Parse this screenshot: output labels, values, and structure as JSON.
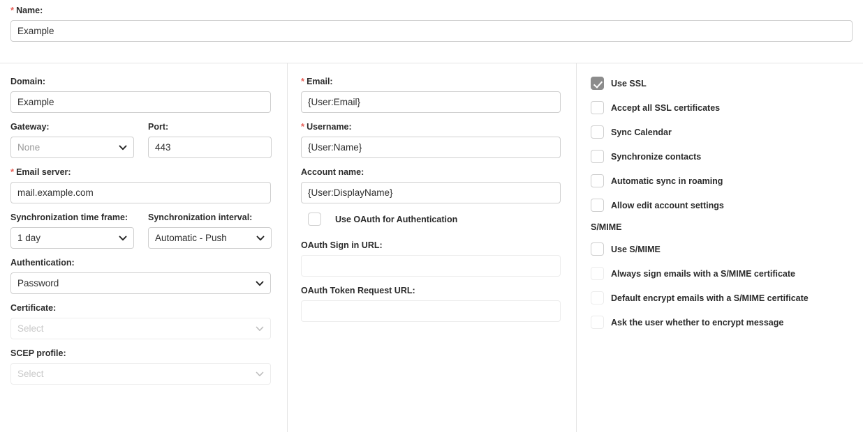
{
  "top": {
    "name": {
      "label": "Name:",
      "required": true,
      "value": "Example",
      "placeholder": ""
    }
  },
  "left_column": {
    "domain": {
      "label": "Domain:",
      "required": false,
      "value": "Example"
    },
    "gateway": {
      "label": "Gateway:",
      "required": false,
      "value": "None",
      "is_placeholder": true,
      "disabled": false
    },
    "port": {
      "label": "Port:",
      "required": false,
      "value": "443"
    },
    "email_server": {
      "label": "Email server:",
      "required": true,
      "value": "mail.example.com"
    },
    "sync_time_frame": {
      "label": "Synchronization time frame:",
      "required": false,
      "value": "1 day"
    },
    "sync_interval": {
      "label": "Synchronization interval:",
      "required": false,
      "value": "Automatic - Push"
    },
    "authentication": {
      "label": "Authentication:",
      "required": false,
      "value": "Password"
    },
    "certificate": {
      "label": "Certificate:",
      "required": false,
      "value": "Select",
      "is_placeholder": true,
      "disabled": true
    },
    "scep_profile": {
      "label": "SCEP profile:",
      "required": false,
      "value": "Select",
      "is_placeholder": true,
      "disabled": true
    }
  },
  "middle_column": {
    "email": {
      "label": "Email:",
      "required": true,
      "value": "{User:Email}"
    },
    "username": {
      "label": "Username:",
      "required": true,
      "value": "{User:Name}"
    },
    "account_name": {
      "label": "Account name:",
      "required": false,
      "value": "{User:DisplayName}"
    },
    "use_oauth": {
      "label": "Use OAuth for Authentication",
      "checked": false,
      "disabled": false
    },
    "oauth_sign_in_url": {
      "label": "OAuth Sign in URL:",
      "required": false,
      "value": "",
      "disabled": true
    },
    "oauth_token_request_url": {
      "label": "OAuth Token Request URL:",
      "required": false,
      "value": "",
      "disabled": true
    }
  },
  "right_column": {
    "checkboxes": [
      {
        "label": "Use SSL",
        "checked": true,
        "disabled": false
      },
      {
        "label": "Accept all SSL certificates",
        "checked": false,
        "disabled": false
      },
      {
        "label": "Sync Calendar",
        "checked": false,
        "disabled": false
      },
      {
        "label": "Synchronize contacts",
        "checked": false,
        "disabled": false
      },
      {
        "label": "Automatic sync in roaming",
        "checked": false,
        "disabled": false
      },
      {
        "label": "Allow edit account settings",
        "checked": false,
        "disabled": false
      }
    ],
    "smime": {
      "heading": "S/MIME",
      "checkboxes": [
        {
          "label": "Use S/MIME",
          "checked": false,
          "disabled": false
        },
        {
          "label": "Always sign emails with a S/MIME certificate",
          "checked": false,
          "disabled": true
        },
        {
          "label": "Default encrypt emails with a S/MIME certificate",
          "checked": false,
          "disabled": true
        },
        {
          "label": "Ask the user whether to encrypt message",
          "checked": false,
          "disabled": true
        }
      ]
    }
  },
  "icons": {
    "chevron_down": "chevron-down-icon",
    "check": "check-icon",
    "required_asterisk": "required-asterisk-icon"
  },
  "colors": {
    "required": "#e8615a",
    "border": "#cfcfcf",
    "border_disabled": "#ececec",
    "checkbox_checked_fill": "#8c8c8c",
    "text": "#2b2b2b",
    "placeholder": "#9a9a9a",
    "divider": "#e4e4e4"
  }
}
